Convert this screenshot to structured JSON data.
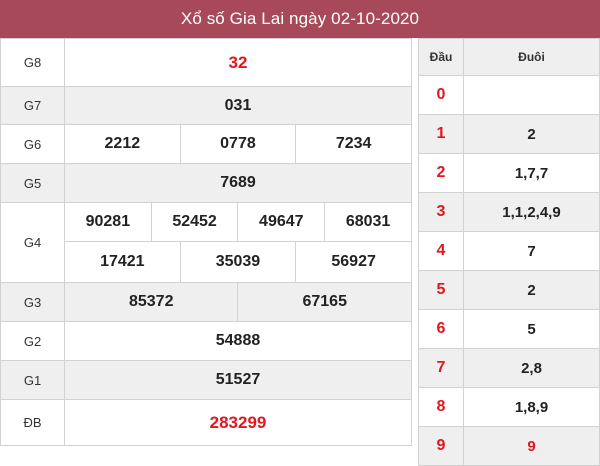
{
  "title": "Xổ số Gia Lai ngày 02-10-2020",
  "prizes": {
    "g8": {
      "label": "G8",
      "values": [
        "32"
      ]
    },
    "g7": {
      "label": "G7",
      "values": [
        "031"
      ]
    },
    "g6": {
      "label": "G6",
      "values": [
        "2212",
        "0778",
        "7234"
      ]
    },
    "g5": {
      "label": "G5",
      "values": [
        "7689"
      ]
    },
    "g4": {
      "label": "G4",
      "values": [
        "90281",
        "52452",
        "49647",
        "68031",
        "17421",
        "35039",
        "56927"
      ]
    },
    "g3": {
      "label": "G3",
      "values": [
        "85372",
        "67165"
      ]
    },
    "g2": {
      "label": "G2",
      "values": [
        "54888"
      ]
    },
    "g1": {
      "label": "G1",
      "values": [
        "51527"
      ]
    },
    "db": {
      "label": "ĐB",
      "values": [
        "283299"
      ]
    }
  },
  "loto": {
    "head_label": "Đầu",
    "tail_label": "Đuôi",
    "rows": [
      {
        "head": "0",
        "tails": ""
      },
      {
        "head": "1",
        "tails": "2"
      },
      {
        "head": "2",
        "tails": "1,7,7"
      },
      {
        "head": "3",
        "tails": "1,1,2,4,9"
      },
      {
        "head": "4",
        "tails": "7"
      },
      {
        "head": "5",
        "tails": "2"
      },
      {
        "head": "6",
        "tails": "5"
      },
      {
        "head": "7",
        "tails": "2,8"
      },
      {
        "head": "8",
        "tails": "1,8,9"
      },
      {
        "head": "9",
        "tails": "9"
      }
    ]
  },
  "colors": {
    "header_bg": "#a8495a",
    "highlight_red": "#e0181e",
    "row_alt": "#efefef"
  }
}
